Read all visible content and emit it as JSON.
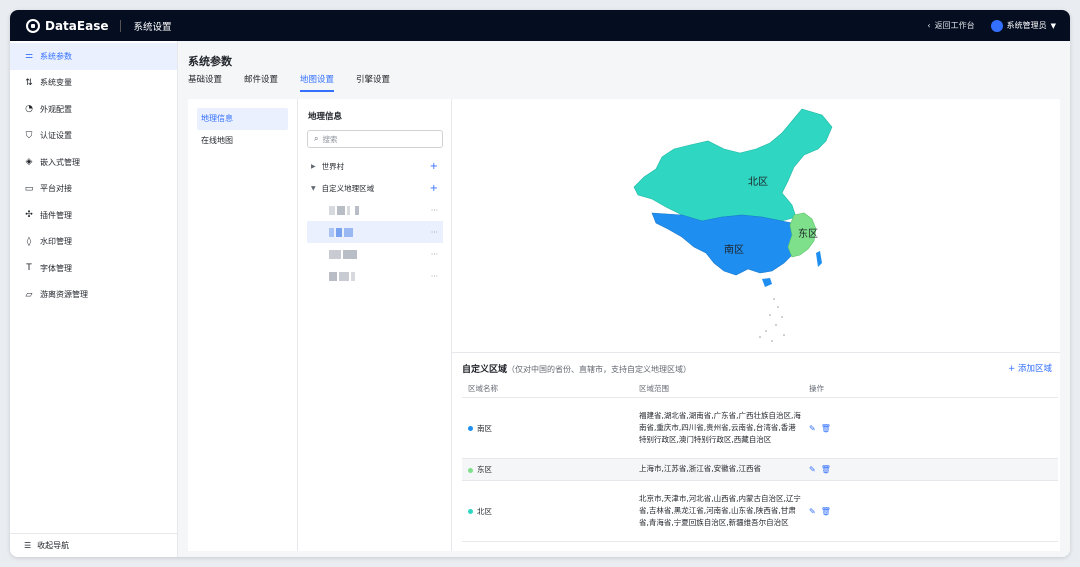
{
  "app": {
    "name": "DataEase",
    "section": "系统设置"
  },
  "topbar": {
    "back_label": "返回工作台",
    "user_label": "系统管理员"
  },
  "sidebar": {
    "items": [
      {
        "label": "系统参数",
        "icon": "sliders-icon",
        "active": true
      },
      {
        "label": "系统变量",
        "icon": "variable-icon"
      },
      {
        "label": "外观配置",
        "icon": "palette-icon"
      },
      {
        "label": "认证设置",
        "icon": "shield-icon"
      },
      {
        "label": "嵌入式管理",
        "icon": "layers-icon"
      },
      {
        "label": "平台对接",
        "icon": "monitor-icon"
      },
      {
        "label": "插件管理",
        "icon": "plugin-icon"
      },
      {
        "label": "水印管理",
        "icon": "droplet-icon"
      },
      {
        "label": "字体管理",
        "icon": "font-icon"
      },
      {
        "label": "游离资源管理",
        "icon": "folder-icon"
      }
    ],
    "collapse_label": "收起导航"
  },
  "page": {
    "title": "系统参数",
    "tabs": [
      {
        "label": "基础设置"
      },
      {
        "label": "邮件设置"
      },
      {
        "label": "地图设置",
        "active": true
      },
      {
        "label": "引擎设置"
      }
    ]
  },
  "sub_nav": {
    "items": [
      {
        "label": "地理信息",
        "active": true
      },
      {
        "label": "在线地图"
      }
    ]
  },
  "tree": {
    "title": "地理信息",
    "search_placeholder": "搜索",
    "nodes": [
      {
        "label": "世界村",
        "expanded": false
      },
      {
        "label": "自定义地理区域",
        "expanded": true
      }
    ],
    "more_glyph": "···"
  },
  "map": {
    "labels": {
      "north": "北区",
      "south": "南区",
      "east": "东区"
    },
    "colors": {
      "north": "#2fd6c1",
      "south": "#1e8ef0",
      "east": "#7ee08a"
    }
  },
  "regions": {
    "title": "自定义区域",
    "hint": "（仅对中国的省份、直辖市，支持自定义地理区域）",
    "add_label": "+ 添加区域",
    "columns": {
      "name": "区域名称",
      "range": "区域范围",
      "actions": "操作"
    },
    "rows": [
      {
        "name": "南区",
        "color": "#1e8ef0",
        "range": "福建省,湖北省,湖南省,广东省,广西壮族自治区,海南省,重庆市,四川省,贵州省,云南省,台湾省,香港特别行政区,澳门特别行政区,西藏自治区"
      },
      {
        "name": "东区",
        "color": "#7ee08a",
        "range": "上海市,江苏省,浙江省,安徽省,江西省"
      },
      {
        "name": "北区",
        "color": "#2fd6c1",
        "range": "北京市,天津市,河北省,山西省,内蒙古自治区,辽宁省,吉林省,黑龙江省,河南省,山东省,陕西省,甘肃省,青海省,宁夏回族自治区,新疆维吾尔自治区"
      }
    ]
  }
}
